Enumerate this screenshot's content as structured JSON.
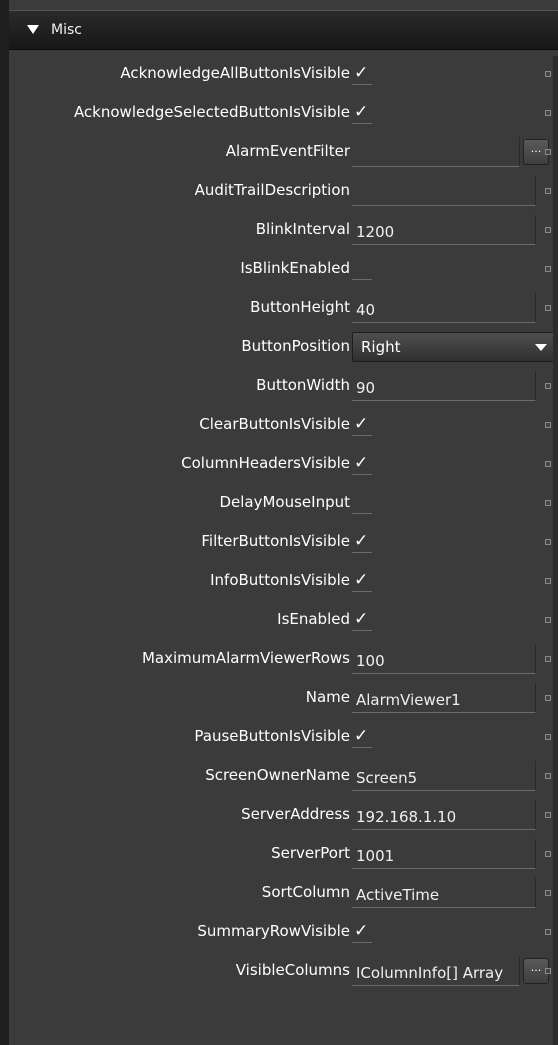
{
  "section": {
    "title": "Misc"
  },
  "properties": [
    {
      "label": "AcknowledgeAllButtonIsVisible",
      "kind": "check",
      "checked": true,
      "mark": "✓"
    },
    {
      "label": "AcknowledgeSelectedButtonIsVisible",
      "kind": "check",
      "checked": true,
      "mark": "✓"
    },
    {
      "label": "AlarmEventFilter",
      "kind": "text-ellipsis",
      "value": "",
      "button": "..."
    },
    {
      "label": "AuditTrailDescription",
      "kind": "text",
      "value": ""
    },
    {
      "label": "BlinkInterval",
      "kind": "text",
      "value": "1200"
    },
    {
      "label": "IsBlinkEnabled",
      "kind": "check",
      "checked": false,
      "mark": ""
    },
    {
      "label": "ButtonHeight",
      "kind": "text",
      "value": "40"
    },
    {
      "label": "ButtonPosition",
      "kind": "combo",
      "value": "Right"
    },
    {
      "label": "ButtonWidth",
      "kind": "text",
      "value": "90"
    },
    {
      "label": "ClearButtonIsVisible",
      "kind": "check",
      "checked": true,
      "mark": "✓"
    },
    {
      "label": "ColumnHeadersVisible",
      "kind": "check",
      "checked": true,
      "mark": "✓"
    },
    {
      "label": "DelayMouseInput",
      "kind": "check",
      "checked": false,
      "mark": ""
    },
    {
      "label": "FilterButtonIsVisible",
      "kind": "check",
      "checked": true,
      "mark": "✓"
    },
    {
      "label": "InfoButtonIsVisible",
      "kind": "check",
      "checked": true,
      "mark": "✓"
    },
    {
      "label": "IsEnabled",
      "kind": "check",
      "checked": true,
      "mark": "✓"
    },
    {
      "label": "MaximumAlarmViewerRows",
      "kind": "text",
      "value": "100"
    },
    {
      "label": "Name",
      "kind": "text",
      "value": "AlarmViewer1"
    },
    {
      "label": "PauseButtonIsVisible",
      "kind": "check",
      "checked": true,
      "mark": "✓"
    },
    {
      "label": "ScreenOwnerName",
      "kind": "text",
      "value": "Screen5"
    },
    {
      "label": "ServerAddress",
      "kind": "text",
      "value": "192.168.1.10"
    },
    {
      "label": "ServerPort",
      "kind": "text",
      "value": "1001"
    },
    {
      "label": "SortColumn",
      "kind": "text",
      "value": "ActiveTime"
    },
    {
      "label": "SummaryRowVisible",
      "kind": "check",
      "checked": true,
      "mark": "✓"
    },
    {
      "label": "VisibleColumns",
      "kind": "text-ellipsis",
      "value": "IColumnInfo[] Array",
      "button": "..."
    }
  ]
}
